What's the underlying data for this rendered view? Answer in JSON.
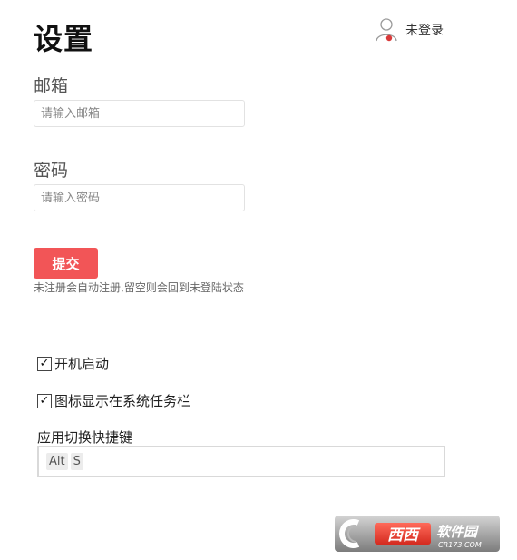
{
  "header": {
    "title": "设置",
    "user_icon": "user-outline-icon",
    "user_status": "未登录",
    "status_dot_color": "#d93a3a"
  },
  "form": {
    "email": {
      "label": "邮箱",
      "placeholder": "请输入邮箱",
      "value": ""
    },
    "password": {
      "label": "密码",
      "placeholder": "请输入密码",
      "value": ""
    },
    "submit_label": "提交",
    "submit_color": "#f25557",
    "hint": "未注册会自动注册,留空则会回到未登陆状态"
  },
  "options": {
    "autostart": {
      "label": "开机启动",
      "checked": true,
      "mark": "✓"
    },
    "tray_icon": {
      "label": "图标显示在系统任务栏",
      "checked": true,
      "mark": "✓"
    }
  },
  "hotkey": {
    "label": "应用切换快捷键",
    "keys": [
      "Alt",
      "S"
    ]
  },
  "watermark": {
    "logo_icon": "cr173-logo-icon",
    "text_main": "西西软件园",
    "text_sub": "CR173.COM"
  }
}
